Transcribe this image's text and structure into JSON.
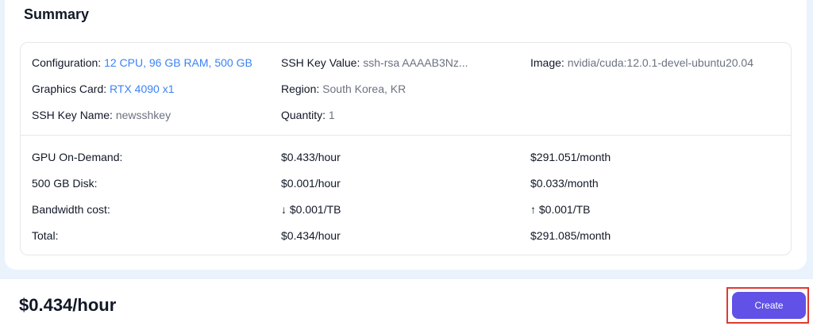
{
  "summary": {
    "title": "Summary",
    "config": {
      "configuration": {
        "label": "Configuration:",
        "value": "12 CPU, 96 GB RAM, 500 GB"
      },
      "ssh_key_value": {
        "label": "SSH Key Value:",
        "value": "ssh-rsa AAAAB3Nz..."
      },
      "image": {
        "label": "Image:",
        "value": "nvidia/cuda:12.0.1-devel-ubuntu20.04"
      },
      "graphics_card": {
        "label": "Graphics Card:",
        "value": "RTX 4090 x1"
      },
      "region": {
        "label": "Region:",
        "value": "South Korea, KR"
      },
      "ssh_key_name": {
        "label": "SSH Key Name:",
        "value": "newsshkey"
      },
      "quantity": {
        "label": "Quantity:",
        "value": "1"
      }
    },
    "costs": [
      {
        "label": "GPU On-Demand:",
        "hourly": "$0.433/hour",
        "monthly": "$291.051/month"
      },
      {
        "label": "500 GB Disk:",
        "hourly": "$0.001/hour",
        "monthly": "$0.033/month"
      },
      {
        "label": "Bandwidth cost:",
        "hourly": "↓ $0.001/TB",
        "monthly": "↑ $0.001/TB"
      },
      {
        "label": "Total:",
        "hourly": "$0.434/hour",
        "monthly": "$291.085/month"
      }
    ]
  },
  "footer": {
    "total_price": "$0.434/hour",
    "create_label": "Create"
  },
  "colors": {
    "accent_value": "#3b82f6",
    "create_button": "#6151e6",
    "highlight_border": "#e03a2f"
  }
}
